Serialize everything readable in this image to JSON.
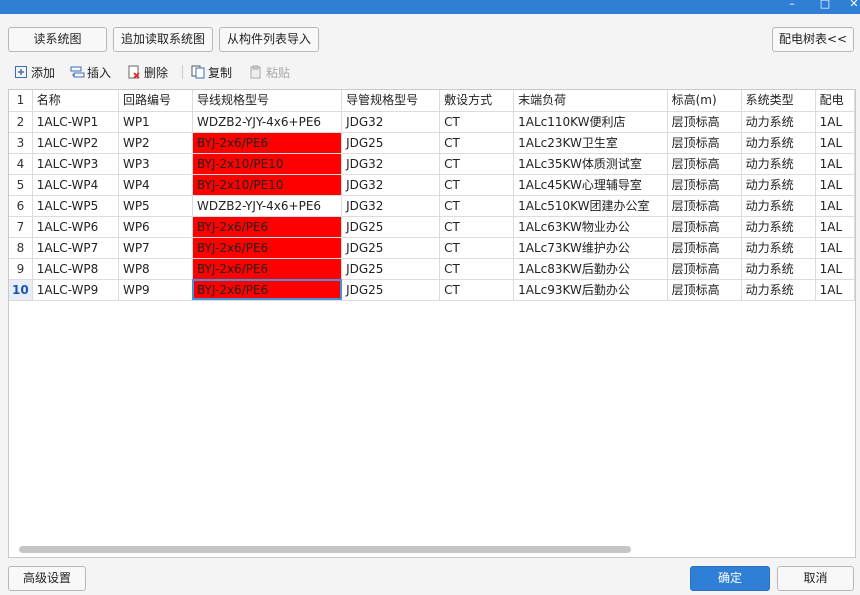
{
  "window": {
    "minimize_label": "–",
    "maximize_label": "□",
    "close_label": "✕"
  },
  "top_buttons": {
    "read_diagram": "读系统图",
    "append_read": "追加读取系统图",
    "import_from_list": "从构件列表导入",
    "distribution_tree": "配电树表<<"
  },
  "toolbar": {
    "add": "添加",
    "insert": "插入",
    "delete": "删除",
    "copy": "复制",
    "paste": "粘贴"
  },
  "table": {
    "columns": [
      "名称",
      "回路编号",
      "导线规格型号",
      "导管规格型号",
      "敷设方式",
      "末端负荷",
      "标高(m)",
      "系统类型",
      "配电"
    ],
    "rows": [
      {
        "num": "2",
        "cells": [
          "1ALC-WP1",
          "WP1",
          "WDZB2-YJY-4x6+PE6",
          "JDG32",
          "CT",
          "1ALc110KW便利店",
          "层顶标高",
          "动力系统",
          "1AL"
        ],
        "red": false
      },
      {
        "num": "3",
        "cells": [
          "1ALC-WP2",
          "WP2",
          "BYJ-2x6/PE6",
          "JDG25",
          "CT",
          "1ALc23KW卫生室",
          "层顶标高",
          "动力系统",
          "1AL"
        ],
        "red": true
      },
      {
        "num": "4",
        "cells": [
          "1ALC-WP3",
          "WP3",
          "BYJ-2x10/PE10",
          "JDG32",
          "CT",
          "1ALc35KW体质测试室",
          "层顶标高",
          "动力系统",
          "1AL"
        ],
        "red": true
      },
      {
        "num": "5",
        "cells": [
          "1ALC-WP4",
          "WP4",
          "BYJ-2x10/PE10",
          "JDG32",
          "CT",
          "1ALc45KW心理辅导室",
          "层顶标高",
          "动力系统",
          "1AL"
        ],
        "red": true
      },
      {
        "num": "6",
        "cells": [
          "1ALC-WP5",
          "WP5",
          "WDZB2-YJY-4x6+PE6",
          "JDG32",
          "CT",
          "1ALc510KW团建办公室",
          "层顶标高",
          "动力系统",
          "1AL"
        ],
        "red": false
      },
      {
        "num": "7",
        "cells": [
          "1ALC-WP6",
          "WP6",
          "BYJ-2x6/PE6",
          "JDG25",
          "CT",
          "1ALc63KW物业办公",
          "层顶标高",
          "动力系统",
          "1AL"
        ],
        "red": true
      },
      {
        "num": "8",
        "cells": [
          "1ALC-WP7",
          "WP7",
          "BYJ-2x6/PE6",
          "JDG25",
          "CT",
          "1ALc73KW维护办公",
          "层顶标高",
          "动力系统",
          "1AL"
        ],
        "red": true
      },
      {
        "num": "9",
        "cells": [
          "1ALC-WP8",
          "WP8",
          "BYJ-2x6/PE6",
          "JDG25",
          "CT",
          "1ALc83KW后勤办公",
          "层顶标高",
          "动力系统",
          "1AL"
        ],
        "red": true
      },
      {
        "num": "10",
        "cells": [
          "1ALC-WP9",
          "WP9",
          "BYJ-2x6/PE6",
          "JDG25",
          "CT",
          "1ALc93KW后勤办公",
          "层顶标高",
          "动力系统",
          "1AL"
        ],
        "red": true
      }
    ],
    "header_row_num": "1"
  },
  "bottom": {
    "advanced": "高级设置",
    "ok": "确定",
    "cancel": "取消"
  },
  "colors": {
    "title_bar": "#2f7fd6",
    "error_cell": "#ff0000",
    "ok_button": "#2f7fd6"
  }
}
